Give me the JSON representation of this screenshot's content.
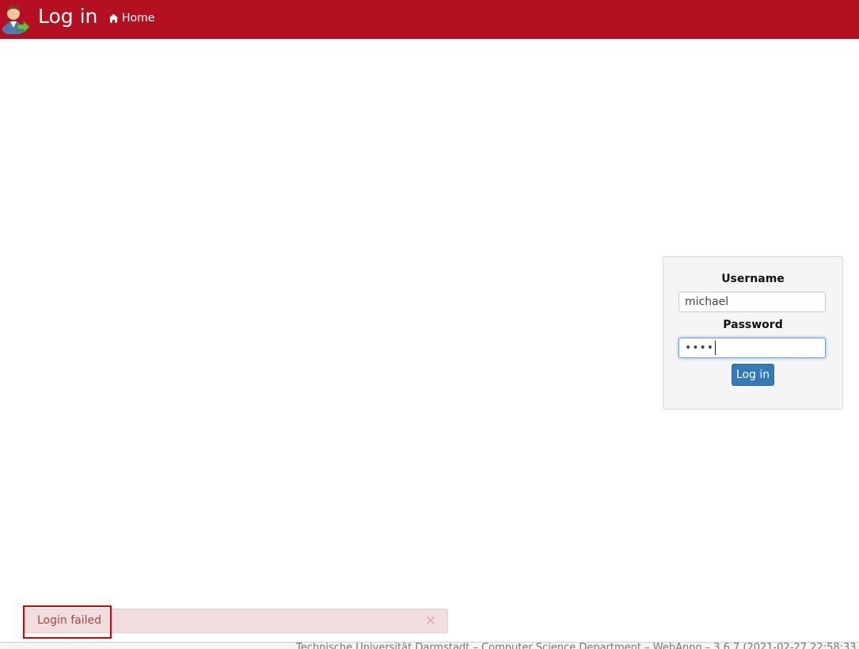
{
  "header": {
    "title": "Log in",
    "home_label": "Home",
    "logo_icon": "user-login-icon",
    "home_icon": "home-icon",
    "bar_color": "#b50f22"
  },
  "login_form": {
    "username_label": "Username",
    "username_value": "michael",
    "password_label": "Password",
    "password_value": "••••",
    "submit_label": "Log in",
    "button_color": "#337ab7"
  },
  "alert": {
    "message": "Login failed",
    "close_glyph": "×",
    "close_icon": "close-icon"
  },
  "footer": {
    "text": "Technische Universität Darmstadt – Computer Science Department – WebAnno – 3.6.7 (2021-02-27 22:58:33"
  }
}
